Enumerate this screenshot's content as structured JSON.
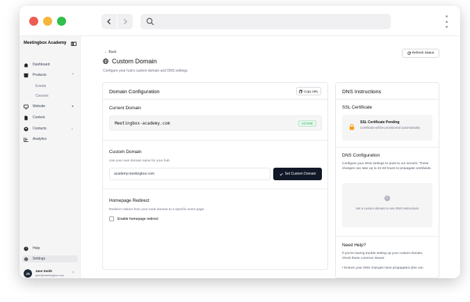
{
  "sidebar": {
    "brand": "Meetingbox Academy",
    "items": [
      {
        "label": "Dashboard"
      },
      {
        "label": "Products"
      },
      {
        "label": "Website"
      },
      {
        "label": "Content"
      },
      {
        "label": "Contacts"
      },
      {
        "label": "Analytics"
      }
    ],
    "sub_items": [
      "Events",
      "Courses"
    ],
    "help": "Help",
    "settings": "Settings",
    "user": {
      "initials": "JS",
      "name": "Jane Smith",
      "email": "jane@meetingbox.com"
    }
  },
  "header": {
    "back": "← Back",
    "title": "Custom Domain",
    "subtitle": "Configure your hub's custom domain and DNS settings",
    "refresh": "Refresh Status"
  },
  "config": {
    "title": "Domain Configuration",
    "copy_url": "Copy URL",
    "current_title": "Current Domain",
    "current_domain": "Meetingbox-academy.com",
    "status": "ACTIVE",
    "custom_title": "Custom Domain",
    "custom_desc": "Use your own domain name for your hub",
    "custom_value": "academy.meetingbox.com",
    "set_button": "Set Custom Domain",
    "redirect_title": "Homepage Redirect",
    "redirect_desc": "Redirect visitors from your main domain to a specific event page",
    "redirect_checkbox": "Enable homepage redirect"
  },
  "dns": {
    "title": "DNS Instructions",
    "ssl_title": "SSL Certificate",
    "ssl_status": "SSL Certificate Pending",
    "ssl_text": "Certificate will be provisioned automatically",
    "config_title": "DNS Configuration",
    "config_text": "Configure your DNS settings to point to our servers. These changes can take up to 24-48 hours to propagate worldwide.",
    "empty_text": "Set a custom domain to see DNS instructions",
    "help_title": "Need Help?",
    "help_text": "If you're having trouble setting up your custom domain, check these common issues:",
    "help_cut": "• Ensure your DNS changes have propagated (this can"
  },
  "colors": {
    "accent_dark": "#111827",
    "active_green": "#16a34a",
    "pending_orange": "#f59e0b",
    "light_red": "#ee5b52",
    "light_yellow": "#f6b63b",
    "light_green": "#2fbf4b"
  }
}
